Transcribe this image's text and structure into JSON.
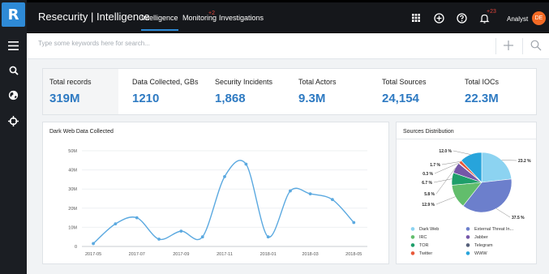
{
  "app": {
    "logo": "R",
    "brand": "Resecurity | Intelligence"
  },
  "nav": [
    {
      "label": "Intelligence",
      "active": true
    },
    {
      "label": "Monitoring",
      "badge": "+2"
    },
    {
      "label": "Investigations"
    }
  ],
  "topbar_icons": [
    "apps-grid-icon",
    "add-circle-icon",
    "help-icon",
    "notifications-icon"
  ],
  "notifications_badge": "+23",
  "user": {
    "name": "Analyst",
    "initials": "DE"
  },
  "search": {
    "placeholder": "Type some keywords here for search..."
  },
  "stats": [
    {
      "label": "Total records",
      "value": "319M"
    },
    {
      "label": "Data Collected, GBs",
      "value": "1210"
    },
    {
      "label": "Security Incidents",
      "value": "1,868"
    },
    {
      "label": "Total Actors",
      "value": "9.3M"
    },
    {
      "label": "Total Sources",
      "value": "24,154"
    },
    {
      "label": "Total IOCs",
      "value": "22.3M"
    }
  ],
  "colors": {
    "accent": "#2e8ad6",
    "value": "#2e7ac2",
    "badge": "#e2453b",
    "avatar": "#f26a25"
  },
  "dark_web_card": {
    "title": "Dark Web Data Collected"
  },
  "sources_card": {
    "title": "Sources Distribution"
  },
  "chart_data": [
    {
      "type": "line",
      "title": "Dark Web Data Collected",
      "y_ticks": [
        "0",
        "10M",
        "20M",
        "30M",
        "40M",
        "50M"
      ],
      "x_ticks": [
        "2017-05",
        "2017-07",
        "2017-09",
        "2017-11",
        "2018-01",
        "2018-03",
        "2018-05"
      ],
      "ylim": [
        0,
        50000000
      ],
      "xlim": [
        "2017-04-15",
        "2018-05-20"
      ],
      "series": [
        {
          "color": "#5ba9e0",
          "points": [
            {
              "x": "2017-05-01",
              "y": 1500000
            },
            {
              "x": "2017-06-01",
              "y": 11800000
            },
            {
              "x": "2017-07-01",
              "y": 15000000
            },
            {
              "x": "2017-08-01",
              "y": 3800000
            },
            {
              "x": "2017-09-01",
              "y": 8000000
            },
            {
              "x": "2017-10-01",
              "y": 5000000
            },
            {
              "x": "2017-11-01",
              "y": 36500000
            },
            {
              "x": "2017-12-01",
              "y": 43000000
            },
            {
              "x": "2018-01-01",
              "y": 5000000
            },
            {
              "x": "2018-02-01",
              "y": 29000000
            },
            {
              "x": "2018-03-01",
              "y": 27500000
            },
            {
              "x": "2018-04-01",
              "y": 24500000
            },
            {
              "x": "2018-05-01",
              "y": 12500000
            }
          ]
        }
      ]
    },
    {
      "type": "pie",
      "title": "Sources Distribution",
      "slices": [
        {
          "name": "Dark Web",
          "value": 23.2,
          "label": "23.2 %",
          "color": "#8cd3f1"
        },
        {
          "name": "External Threat In...",
          "value": 37.5,
          "label": "37.5 %",
          "color": "#6c7fcc"
        },
        {
          "name": "IRC",
          "value": 12.9,
          "label": "12.9 %",
          "color": "#62bd6c"
        },
        {
          "name": "Jabber",
          "value": 5.8,
          "label": "5.8 %",
          "color": "#7556a8"
        },
        {
          "name": "TOR",
          "value": 6.7,
          "label": "6.7 %",
          "color": "#1e9e6a"
        },
        {
          "name": "Telegram",
          "value": 0.3,
          "label": "0.3 %",
          "color": "#56607a"
        },
        {
          "name": "Twitter",
          "value": 1.7,
          "label": "1.7 %",
          "color": "#e8593a"
        },
        {
          "name": "WWW",
          "value": 12.0,
          "label": "12.0 %",
          "color": "#27a4db"
        }
      ]
    }
  ]
}
